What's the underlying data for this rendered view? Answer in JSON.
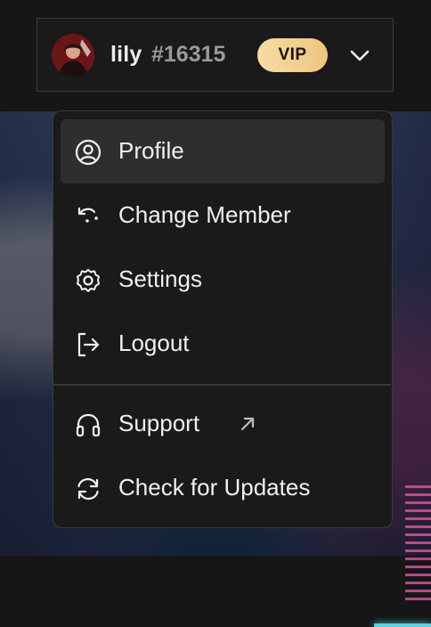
{
  "header": {
    "username": "lily",
    "usertag": "#16315",
    "badge": "VIP",
    "dropdown_icon": "chevron-down-icon",
    "avatar_icon": "avatar"
  },
  "menu": {
    "items": [
      {
        "label": "Profile",
        "icon": "user-circle-icon",
        "active": true
      },
      {
        "label": "Change Member",
        "icon": "undo-arrow-icon"
      },
      {
        "label": "Settings",
        "icon": "gear-icon"
      },
      {
        "label": "Logout",
        "icon": "logout-icon"
      }
    ],
    "secondary": [
      {
        "label": "Support",
        "icon": "headphones-icon",
        "external_icon": "external-arrow-icon"
      },
      {
        "label": "Check for Updates",
        "icon": "refresh-icon"
      }
    ]
  },
  "colors": {
    "background": "#161616",
    "menu_background": "#1a1a1a",
    "active_item": "#2e2e2e",
    "vip_gold": "#eec580",
    "text": "#f0f0f0",
    "muted_text": "#9a9a9a"
  }
}
